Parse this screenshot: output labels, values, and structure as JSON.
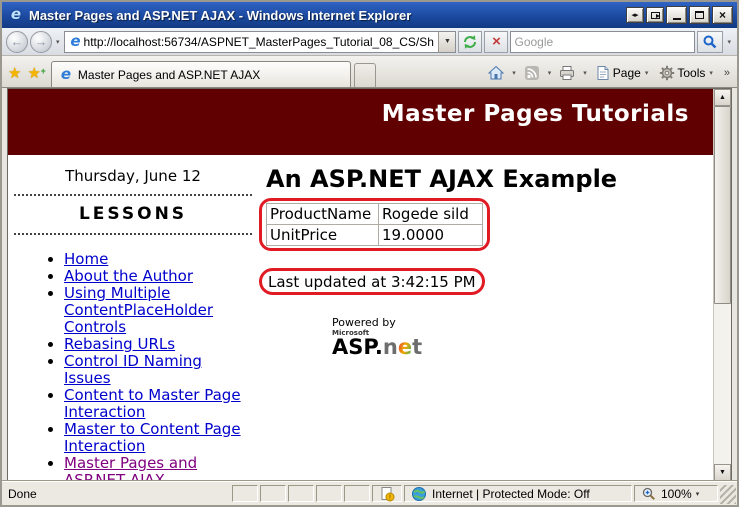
{
  "window": {
    "title": "Master Pages and ASP.NET AJAX - Windows Internet Explorer"
  },
  "chrome": {
    "url": "http://localhost:56734/ASPNET_MasterPages_Tutorial_08_CS/Sh",
    "search_placeholder": "Google",
    "tab_title": "Master Pages and ASP.NET AJAX",
    "page_label": "Page",
    "tools_label": "Tools",
    "overflow_chevron": "»",
    "back_glyph": "←",
    "forward_glyph": "→",
    "star_glyph": "★",
    "plus_glyph": "+",
    "drop_glyph": "▾",
    "up_glyph": "▲",
    "down_glyph": "▼",
    "stop_glyph": "×"
  },
  "page": {
    "banner_title": "Master Pages Tutorials",
    "sidebar": {
      "date": "Thursday, June 12",
      "heading": "LESSONS",
      "links": [
        {
          "label": "Home",
          "visited": false
        },
        {
          "label": "About the Author",
          "visited": false
        },
        {
          "label": "Using Multiple ContentPlaceHolder Controls",
          "visited": false
        },
        {
          "label": "Rebasing URLs",
          "visited": false
        },
        {
          "label": "Control ID Naming Issues",
          "visited": false
        },
        {
          "label": "Content to Master Page Interaction",
          "visited": false
        },
        {
          "label": "Master to Content Page Interaction",
          "visited": false
        },
        {
          "label": "Master Pages and ASP.NET AJAX",
          "visited": true
        }
      ]
    },
    "main": {
      "heading": "An ASP.NET AJAX Example",
      "product_table": {
        "rows": [
          {
            "label": "ProductName",
            "value": "Rogede sild"
          },
          {
            "label": "UnitPrice",
            "value": "19.0000"
          }
        ]
      },
      "last_updated": "Last updated at 3:42:15 PM",
      "logo": {
        "powered_by": "Powered by",
        "microsoft": "Microsoft",
        "asp": "ASP.",
        "n": "n",
        "e": "e",
        "t": "t"
      }
    }
  },
  "status_bar": {
    "status": "Done",
    "zone_text": "Internet | Protected Mode: Off",
    "zoom_level": "100%"
  },
  "colors": {
    "banner": "#600000",
    "annotation": "#e01b24",
    "link": "#0000cc",
    "visited_link": "#800080"
  }
}
